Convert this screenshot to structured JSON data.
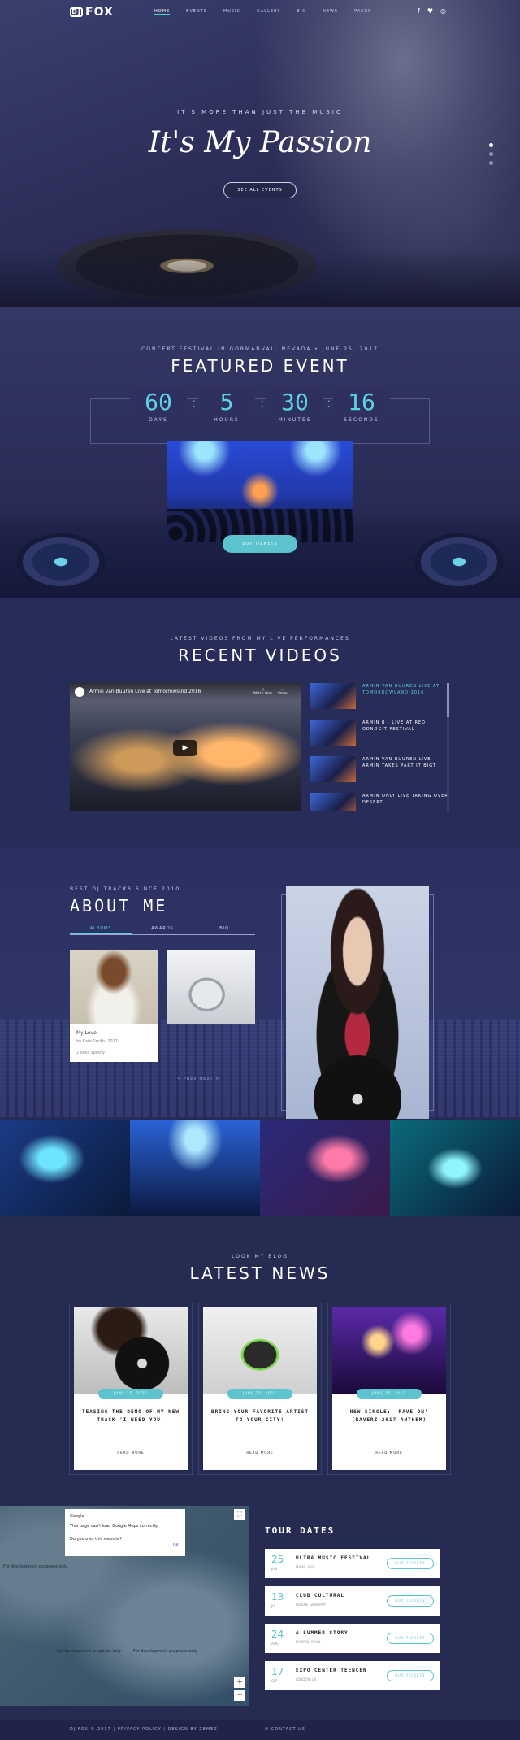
{
  "header": {
    "logo": "FOX",
    "nav": [
      "HOME",
      "EVENTS",
      "MUSIC",
      "GALLERY",
      "BIO",
      "NEWS",
      "PAGES"
    ],
    "hero_kicker": "IT'S MORE THAN JUST THE MUSIC",
    "hero_title": "It's My Passion",
    "hero_button": "SEE ALL EVENTS"
  },
  "featured": {
    "kicker": "CONCERT FESTIVAL IN GORMANVAL, NEVADA • JUNE 25, 2017",
    "title": "FEATURED EVENT",
    "countdown": [
      {
        "value": "60",
        "label": "DAYS"
      },
      {
        "value": "5",
        "label": "HOURS"
      },
      {
        "value": "30",
        "label": "MINUTES"
      },
      {
        "value": "16",
        "label": "SECONDS"
      }
    ],
    "button": "BUY TICKETS"
  },
  "videos": {
    "kicker": "LATEST VIDEOS FROM MY LIVE PERFORMANCES",
    "title": "RECENT VIDEOS",
    "player_title": "Armin van Buuren Live at Tomorrowland 2016",
    "watch_later": "Watch later",
    "share": "Share",
    "playlist": [
      "ARMIN VAN BUUREN LIVE AT TOMORROWLAND 2016",
      "ARMIN B - LIVE AT RED ODNOGIT FESTIVAL",
      "ARMIN VAN BUUREN LIVE - ARMIN TAKES PART IT BIGT",
      "ARMIN ONLY LIVE TAKING OVER DESERT"
    ]
  },
  "about": {
    "kicker": "BEST DJ TRACKS SINCE 2010",
    "title": "ABOUT ME",
    "tabs": [
      "ALBUMS",
      "AWARDS",
      "BIO"
    ],
    "card_title": "My Love",
    "card_sub": "by Kate Smith, 2017",
    "card_icons": "2 likes   Spotify",
    "pager": "< PREV     NEXT >"
  },
  "news": {
    "kicker": "LOOK MY BLOG",
    "title": "LATEST NEWS",
    "items": [
      {
        "date": "JUNE 25, 2017",
        "title": "TEASING THE DEMO OF MY NEW TRACK 'I NEED YOU'",
        "more": "READ MORE"
      },
      {
        "date": "JUNE 25, 2017",
        "title": "BRING YOUR FAVORITE ARTIST TO YOUR CITY!",
        "more": "READ MORE"
      },
      {
        "date": "JUNE 25, 2017",
        "title": "NEW SINGLE: 'RAVE ON' (RAVERZ 2017 ANTHEM)",
        "more": "READ MORE"
      }
    ]
  },
  "map": {
    "google": "Google",
    "error": "This page can't load Google Maps correctly.",
    "question": "Do you own this website?",
    "ok": "OK",
    "labels": [
      "For development purposes only",
      "For development purposes only",
      "For development purposes only"
    ]
  },
  "tour": {
    "title": "TOUR DATES",
    "rows": [
      {
        "day": "25",
        "month": "JUN",
        "name": "ULTRA MUSIC FESTIVAL",
        "loc": "MIAMI, USA",
        "button": "BUY TICKETS"
      },
      {
        "day": "13",
        "month": "JUL",
        "name": "CLUB CULTURAL",
        "loc": "BERLIN, GERMANY",
        "button": "BUY TICKETS"
      },
      {
        "day": "24",
        "month": "AUG",
        "name": "A SUMMER STORY",
        "loc": "MADRID, SPAIN",
        "button": "BUY TICKETS"
      },
      {
        "day": "17",
        "month": "SEP",
        "name": "EXPO CENTER TEENCEN",
        "loc": "LONDON, UK",
        "button": "BUY TICKETS"
      }
    ]
  },
  "footer": {
    "left": "DJ FOX © 2017 | PRIVACY POLICY | DESIGN BY ZEMEZ",
    "right": "CONTACT US"
  }
}
